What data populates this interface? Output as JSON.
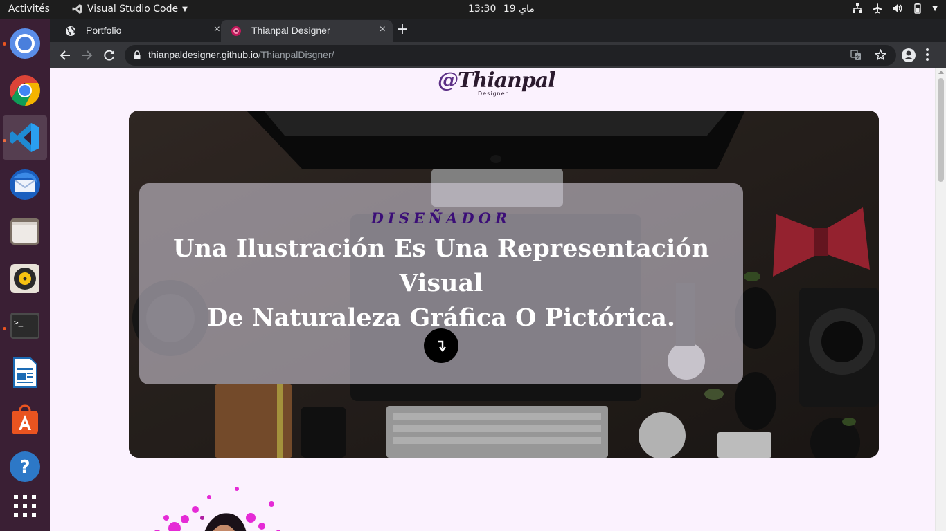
{
  "topbar": {
    "activities": "Activités",
    "app_name": "Visual Studio Code",
    "clock_time": "13:30",
    "clock_date": "ماي 19"
  },
  "dock": {
    "apps": [
      "chrome-dev-icon",
      "chrome-icon",
      "vscode-icon",
      "thunderbird-icon",
      "files-icon",
      "rhythmbox-icon",
      "terminal-icon",
      "writer-icon",
      "software-center-icon",
      "help-icon",
      "show-apps-icon"
    ]
  },
  "browser": {
    "tabs": [
      {
        "label": "Portfolio",
        "close": "×"
      },
      {
        "label": "Thianpal Designer",
        "close": "×"
      }
    ],
    "new_tab": "+",
    "url_host": "thianpaldesigner.github.io",
    "url_path": "/ThianpalDisgner/"
  },
  "page": {
    "logo_text": "Thianpal",
    "logo_at": "@",
    "logo_sub": "Designer",
    "hero": {
      "kicker": "DISEÑADOR",
      "headline_line1": "Una Ilustración Es Una Representación Visual",
      "headline_line2": "De Naturaleza Gráfica O Pictórica.",
      "button_symbol": "↴"
    }
  },
  "colors": {
    "accent_purple": "#3b0e77",
    "page_bg": "#fbf2fe",
    "dock_bg": "#3a1f34",
    "ubuntu_orange": "#e95420"
  }
}
